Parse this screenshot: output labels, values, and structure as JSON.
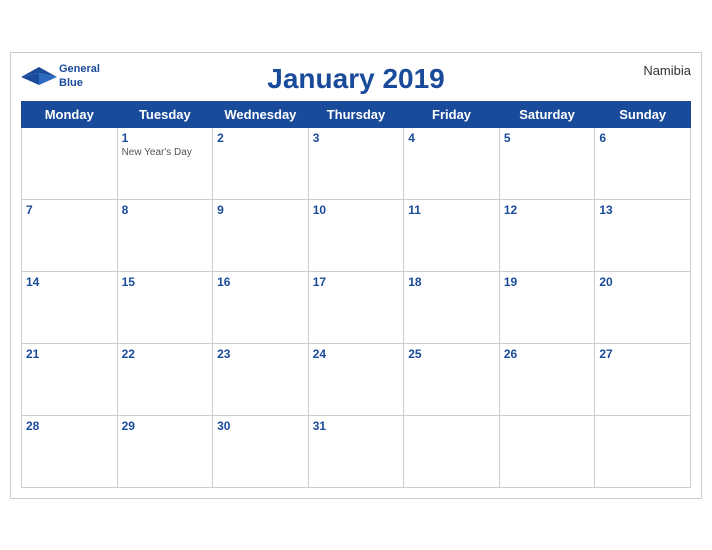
{
  "header": {
    "logo": {
      "line1": "General",
      "line2": "Blue"
    },
    "title": "January 2019",
    "country": "Namibia"
  },
  "weekdays": [
    "Monday",
    "Tuesday",
    "Wednesday",
    "Thursday",
    "Friday",
    "Saturday",
    "Sunday"
  ],
  "weeks": [
    [
      {
        "day": "",
        "empty": true
      },
      {
        "day": "1",
        "holiday": "New Year's Day"
      },
      {
        "day": "2"
      },
      {
        "day": "3"
      },
      {
        "day": "4"
      },
      {
        "day": "5"
      },
      {
        "day": "6"
      }
    ],
    [
      {
        "day": "7"
      },
      {
        "day": "8"
      },
      {
        "day": "9"
      },
      {
        "day": "10"
      },
      {
        "day": "11"
      },
      {
        "day": "12"
      },
      {
        "day": "13"
      }
    ],
    [
      {
        "day": "14"
      },
      {
        "day": "15"
      },
      {
        "day": "16"
      },
      {
        "day": "17"
      },
      {
        "day": "18"
      },
      {
        "day": "19"
      },
      {
        "day": "20"
      }
    ],
    [
      {
        "day": "21"
      },
      {
        "day": "22"
      },
      {
        "day": "23"
      },
      {
        "day": "24"
      },
      {
        "day": "25"
      },
      {
        "day": "26"
      },
      {
        "day": "27"
      }
    ],
    [
      {
        "day": "28"
      },
      {
        "day": "29"
      },
      {
        "day": "30"
      },
      {
        "day": "31"
      },
      {
        "day": "",
        "empty": true
      },
      {
        "day": "",
        "empty": true
      },
      {
        "day": "",
        "empty": true
      }
    ]
  ]
}
